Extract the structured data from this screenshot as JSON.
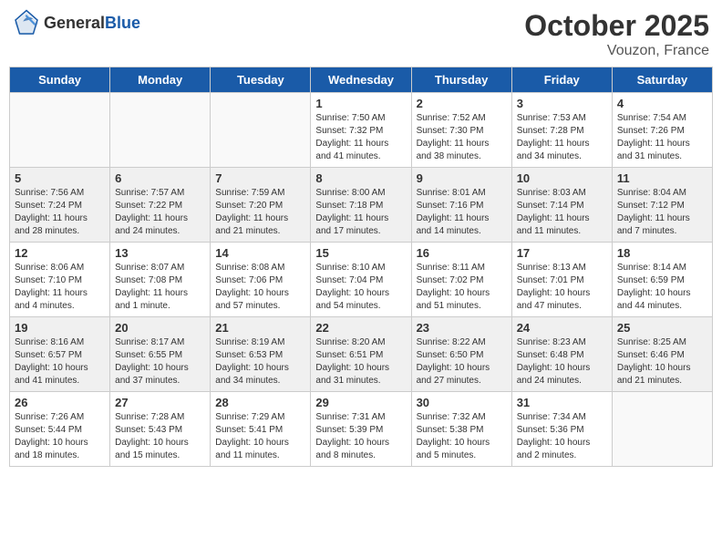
{
  "header": {
    "logo_general": "General",
    "logo_blue": "Blue",
    "month_title": "October 2025",
    "location": "Vouzon, France"
  },
  "weekdays": [
    "Sunday",
    "Monday",
    "Tuesday",
    "Wednesday",
    "Thursday",
    "Friday",
    "Saturday"
  ],
  "weeks": [
    [
      {
        "day": "",
        "info": ""
      },
      {
        "day": "",
        "info": ""
      },
      {
        "day": "",
        "info": ""
      },
      {
        "day": "1",
        "info": "Sunrise: 7:50 AM\nSunset: 7:32 PM\nDaylight: 11 hours and 41 minutes."
      },
      {
        "day": "2",
        "info": "Sunrise: 7:52 AM\nSunset: 7:30 PM\nDaylight: 11 hours and 38 minutes."
      },
      {
        "day": "3",
        "info": "Sunrise: 7:53 AM\nSunset: 7:28 PM\nDaylight: 11 hours and 34 minutes."
      },
      {
        "day": "4",
        "info": "Sunrise: 7:54 AM\nSunset: 7:26 PM\nDaylight: 11 hours and 31 minutes."
      }
    ],
    [
      {
        "day": "5",
        "info": "Sunrise: 7:56 AM\nSunset: 7:24 PM\nDaylight: 11 hours and 28 minutes."
      },
      {
        "day": "6",
        "info": "Sunrise: 7:57 AM\nSunset: 7:22 PM\nDaylight: 11 hours and 24 minutes."
      },
      {
        "day": "7",
        "info": "Sunrise: 7:59 AM\nSunset: 7:20 PM\nDaylight: 11 hours and 21 minutes."
      },
      {
        "day": "8",
        "info": "Sunrise: 8:00 AM\nSunset: 7:18 PM\nDaylight: 11 hours and 17 minutes."
      },
      {
        "day": "9",
        "info": "Sunrise: 8:01 AM\nSunset: 7:16 PM\nDaylight: 11 hours and 14 minutes."
      },
      {
        "day": "10",
        "info": "Sunrise: 8:03 AM\nSunset: 7:14 PM\nDaylight: 11 hours and 11 minutes."
      },
      {
        "day": "11",
        "info": "Sunrise: 8:04 AM\nSunset: 7:12 PM\nDaylight: 11 hours and 7 minutes."
      }
    ],
    [
      {
        "day": "12",
        "info": "Sunrise: 8:06 AM\nSunset: 7:10 PM\nDaylight: 11 hours and 4 minutes."
      },
      {
        "day": "13",
        "info": "Sunrise: 8:07 AM\nSunset: 7:08 PM\nDaylight: 11 hours and 1 minute."
      },
      {
        "day": "14",
        "info": "Sunrise: 8:08 AM\nSunset: 7:06 PM\nDaylight: 10 hours and 57 minutes."
      },
      {
        "day": "15",
        "info": "Sunrise: 8:10 AM\nSunset: 7:04 PM\nDaylight: 10 hours and 54 minutes."
      },
      {
        "day": "16",
        "info": "Sunrise: 8:11 AM\nSunset: 7:02 PM\nDaylight: 10 hours and 51 minutes."
      },
      {
        "day": "17",
        "info": "Sunrise: 8:13 AM\nSunset: 7:01 PM\nDaylight: 10 hours and 47 minutes."
      },
      {
        "day": "18",
        "info": "Sunrise: 8:14 AM\nSunset: 6:59 PM\nDaylight: 10 hours and 44 minutes."
      }
    ],
    [
      {
        "day": "19",
        "info": "Sunrise: 8:16 AM\nSunset: 6:57 PM\nDaylight: 10 hours and 41 minutes."
      },
      {
        "day": "20",
        "info": "Sunrise: 8:17 AM\nSunset: 6:55 PM\nDaylight: 10 hours and 37 minutes."
      },
      {
        "day": "21",
        "info": "Sunrise: 8:19 AM\nSunset: 6:53 PM\nDaylight: 10 hours and 34 minutes."
      },
      {
        "day": "22",
        "info": "Sunrise: 8:20 AM\nSunset: 6:51 PM\nDaylight: 10 hours and 31 minutes."
      },
      {
        "day": "23",
        "info": "Sunrise: 8:22 AM\nSunset: 6:50 PM\nDaylight: 10 hours and 27 minutes."
      },
      {
        "day": "24",
        "info": "Sunrise: 8:23 AM\nSunset: 6:48 PM\nDaylight: 10 hours and 24 minutes."
      },
      {
        "day": "25",
        "info": "Sunrise: 8:25 AM\nSunset: 6:46 PM\nDaylight: 10 hours and 21 minutes."
      }
    ],
    [
      {
        "day": "26",
        "info": "Sunrise: 7:26 AM\nSunset: 5:44 PM\nDaylight: 10 hours and 18 minutes."
      },
      {
        "day": "27",
        "info": "Sunrise: 7:28 AM\nSunset: 5:43 PM\nDaylight: 10 hours and 15 minutes."
      },
      {
        "day": "28",
        "info": "Sunrise: 7:29 AM\nSunset: 5:41 PM\nDaylight: 10 hours and 11 minutes."
      },
      {
        "day": "29",
        "info": "Sunrise: 7:31 AM\nSunset: 5:39 PM\nDaylight: 10 hours and 8 minutes."
      },
      {
        "day": "30",
        "info": "Sunrise: 7:32 AM\nSunset: 5:38 PM\nDaylight: 10 hours and 5 minutes."
      },
      {
        "day": "31",
        "info": "Sunrise: 7:34 AM\nSunset: 5:36 PM\nDaylight: 10 hours and 2 minutes."
      },
      {
        "day": "",
        "info": ""
      }
    ]
  ]
}
